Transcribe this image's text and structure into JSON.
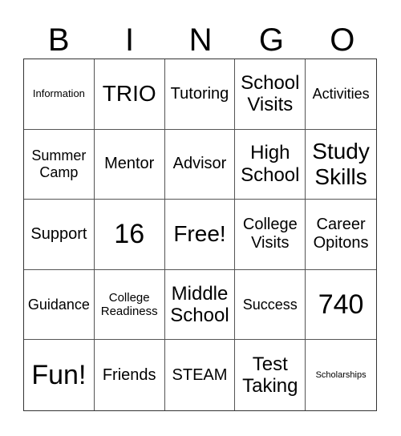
{
  "header": [
    "B",
    "I",
    "N",
    "G",
    "O"
  ],
  "cells": [
    "Information",
    "TRIO",
    "Tutoring",
    "School Visits",
    "Activities",
    "Summer Camp",
    "Mentor",
    "Advisor",
    "High School",
    "Study Skills",
    "Support",
    "16",
    "Free!",
    "College Visits",
    "Career Opitons",
    "Guidance",
    "College Readiness",
    "Middle School",
    "Success",
    "740",
    "Fun!",
    "Friends",
    "STEAM",
    "Test Taking",
    "Scholarships"
  ]
}
